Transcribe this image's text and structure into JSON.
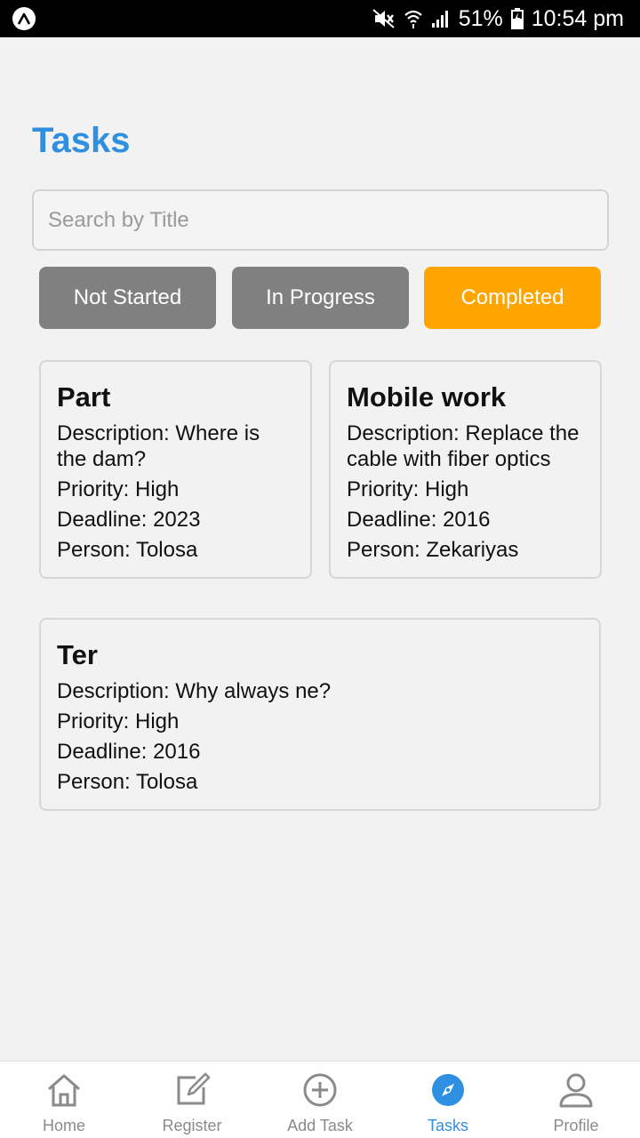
{
  "status_bar": {
    "battery": "51%",
    "time": "10:54 pm"
  },
  "page": {
    "title": "Tasks"
  },
  "search": {
    "placeholder": "Search by Title",
    "value": ""
  },
  "filters": [
    {
      "label": "Not Started",
      "active": false
    },
    {
      "label": "In Progress",
      "active": false
    },
    {
      "label": "Completed",
      "active": true
    }
  ],
  "tasks": [
    {
      "title": "Part",
      "description": "Description: Where is the dam?",
      "priority": "Priority: High",
      "deadline": "Deadline: 2023",
      "person": "Person: Tolosa"
    },
    {
      "title": "Mobile work",
      "description": "Description: Replace the cable with fiber optics",
      "priority": "Priority: High",
      "deadline": "Deadline: 2016",
      "person": "Person: Zekariyas"
    },
    {
      "title": "Ter",
      "description": "Description: Why always ne?",
      "priority": "Priority: High",
      "deadline": "Deadline: 2016",
      "person": "Person: Tolosa"
    }
  ],
  "nav": [
    {
      "label": "Home",
      "icon": "home-icon"
    },
    {
      "label": "Register",
      "icon": "edit-icon"
    },
    {
      "label": "Add Task",
      "icon": "add-circle-icon"
    },
    {
      "label": "Tasks",
      "icon": "compass-icon",
      "active": true
    },
    {
      "label": "Profile",
      "icon": "person-icon"
    }
  ],
  "colors": {
    "accent": "#2f8fe0",
    "active_filter": "#ffa500",
    "inactive_filter": "#808080",
    "background": "#f2f2f2"
  }
}
